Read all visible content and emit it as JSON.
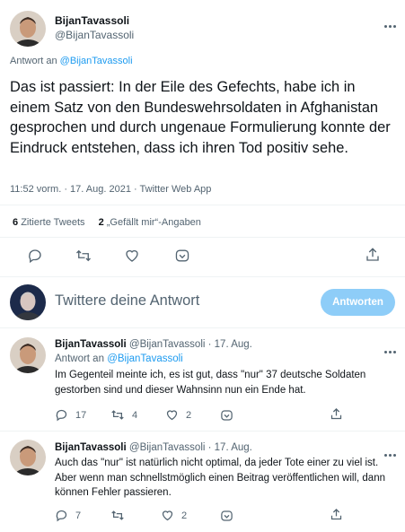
{
  "main_tweet": {
    "display_name": "BijanTavassoli",
    "handle": "@BijanTavassoli",
    "reply_to_prefix": "Antwort an",
    "reply_to_handle": "@BijanTavassoli",
    "text": "Das ist passiert: In der Eile des Gefechts, habe ich in einem Satz von den Bundeswehrsoldaten in Afghanistan gesprochen und durch ungenaue Formulierung konnte der Eindruck entstehen, dass ich ihren Tod positiv sehe.",
    "meta": "11:52 vorm. · 17. Aug. 2021 · Twitter Web App",
    "quote_count": "6",
    "quote_label": "Zitierte Tweets",
    "like_count": "2",
    "like_label": "„Gefällt mir“-Angaben"
  },
  "composer": {
    "placeholder": "Twittere deine Antwort",
    "button_label": "Antworten"
  },
  "replies": [
    {
      "display_name": "BijanTavassoli",
      "handle_date": "@BijanTavassoli · 17. Aug.",
      "reply_to_prefix": "Antwort an",
      "reply_to_handle": "@BijanTavassoli",
      "text": "Im Gegenteil meinte ich, es ist gut, dass \"nur\" 37 deutsche Soldaten gestorben sind und dieser Wahnsinn nun ein Ende hat.",
      "replies": "17",
      "retweets": "4",
      "likes": "2"
    },
    {
      "display_name": "BijanTavassoli",
      "handle_date": "@BijanTavassoli · 17. Aug.",
      "text": "Auch das \"nur\" ist natürlich nicht optimal, da jeder Tote einer zu viel ist. Aber wenn man schnellstmöglich einen Beitrag veröffentlichen will, dann können Fehler passieren.",
      "replies": "7",
      "retweets": "",
      "likes": "2"
    }
  ],
  "colors": {
    "accent": "#1d9bf0",
    "text": "#0f1419",
    "muted": "#536471",
    "button_disabled": "#8ecdf8"
  }
}
